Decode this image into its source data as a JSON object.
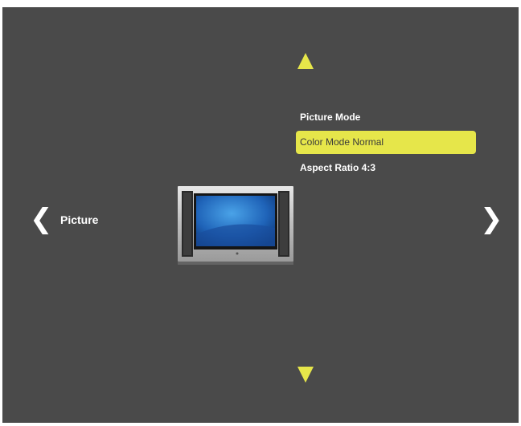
{
  "category": {
    "label": "Picture"
  },
  "menu": {
    "items": [
      {
        "label": "Picture Mode",
        "selected": false
      },
      {
        "label": "Color Mode Normal",
        "selected": true
      },
      {
        "label": "Aspect Ratio 4:3",
        "selected": false
      }
    ]
  },
  "nav": {
    "left_glyph": "❮",
    "right_glyph": "❯",
    "up_icon": "triangle-up-icon",
    "down_icon": "triangle-down-icon"
  },
  "preview": {
    "icon": "tv-icon"
  },
  "colors": {
    "background": "#4a4a4a",
    "accent": "#e6e64a",
    "text": "#ffffff"
  }
}
